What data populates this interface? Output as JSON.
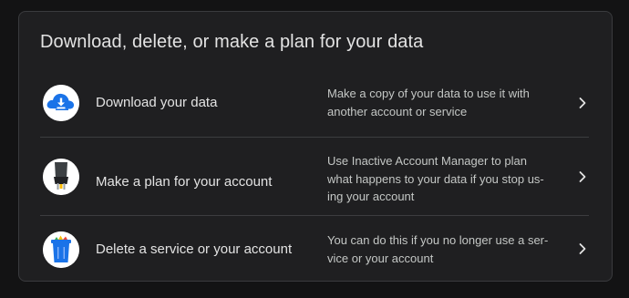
{
  "section": {
    "title": "Download, delete, or make a plan for your data"
  },
  "items": [
    {
      "label": "Download your data",
      "description_lines": [
        "Make a copy of your data to use it with",
        "another account or service"
      ],
      "icon": "cloud-download-icon"
    },
    {
      "label": "Make a plan for your account",
      "description_lines": [
        "Use Inactive Account Manager to plan",
        "what happens to your data if you stop us-",
        "ing your account"
      ],
      "icon": "power-plug-icon"
    },
    {
      "label": "Delete a service or your account",
      "description_lines": [
        "You can do this if you no longer use a ser-",
        "vice or your account"
      ],
      "icon": "trash-can-icon"
    }
  ],
  "colors": {
    "background": "#131314",
    "card": "#1f1f21",
    "text_primary": "#e3e3e3",
    "text_secondary": "#c4c7c5",
    "accent_blue": "#1a73e8"
  }
}
